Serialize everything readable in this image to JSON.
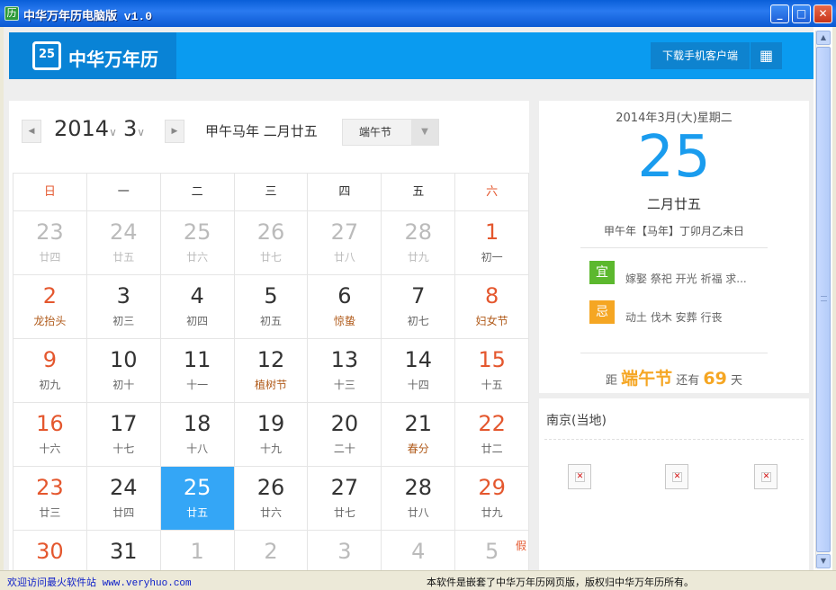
{
  "window": {
    "title": "中华万年历电脑版 v1.0",
    "controls": {
      "minimize": "_",
      "maximize": "□",
      "close": "✕"
    }
  },
  "header": {
    "logo_icon_text": "25",
    "logo_text": "中华万年历",
    "download_label": "下载手机客户端",
    "qr_icon": "qr-code-icon"
  },
  "calendar": {
    "prev_arrow": "◀",
    "next_arrow": "▶",
    "year": "2014",
    "month": "3",
    "caret": "∨",
    "lunar_label": "甲午马年 二月廿五",
    "festival_select": "端午节",
    "festival_arrow": "▼",
    "weekdays": [
      "日",
      "一",
      "二",
      "三",
      "四",
      "五",
      "六"
    ],
    "weeks": [
      [
        {
          "d": "23",
          "s": "廿四",
          "other": true
        },
        {
          "d": "24",
          "s": "廿五",
          "other": true
        },
        {
          "d": "25",
          "s": "廿六",
          "other": true
        },
        {
          "d": "26",
          "s": "廿七",
          "other": true
        },
        {
          "d": "27",
          "s": "廿八",
          "other": true
        },
        {
          "d": "28",
          "s": "廿九",
          "other": true
        },
        {
          "d": "1",
          "s": "初一"
        }
      ],
      [
        {
          "d": "2",
          "s": "龙抬头",
          "fest": true
        },
        {
          "d": "3",
          "s": "初三"
        },
        {
          "d": "4",
          "s": "初四"
        },
        {
          "d": "5",
          "s": "初五"
        },
        {
          "d": "6",
          "s": "惊蛰",
          "fest": true
        },
        {
          "d": "7",
          "s": "初七"
        },
        {
          "d": "8",
          "s": "妇女节",
          "fest": true
        }
      ],
      [
        {
          "d": "9",
          "s": "初九"
        },
        {
          "d": "10",
          "s": "初十"
        },
        {
          "d": "11",
          "s": "十一"
        },
        {
          "d": "12",
          "s": "植树节",
          "fest": true
        },
        {
          "d": "13",
          "s": "十三"
        },
        {
          "d": "14",
          "s": "十四"
        },
        {
          "d": "15",
          "s": "十五"
        }
      ],
      [
        {
          "d": "16",
          "s": "十六"
        },
        {
          "d": "17",
          "s": "十七"
        },
        {
          "d": "18",
          "s": "十八"
        },
        {
          "d": "19",
          "s": "十九"
        },
        {
          "d": "20",
          "s": "二十"
        },
        {
          "d": "21",
          "s": "春分",
          "fest": true
        },
        {
          "d": "22",
          "s": "廿二"
        }
      ],
      [
        {
          "d": "23",
          "s": "廿三"
        },
        {
          "d": "24",
          "s": "廿四"
        },
        {
          "d": "25",
          "s": "廿五",
          "selected": true
        },
        {
          "d": "26",
          "s": "廿六"
        },
        {
          "d": "27",
          "s": "廿七"
        },
        {
          "d": "28",
          "s": "廿八"
        },
        {
          "d": "29",
          "s": "廿九"
        }
      ],
      [
        {
          "d": "30",
          "s": ""
        },
        {
          "d": "31",
          "s": ""
        },
        {
          "d": "1",
          "s": "",
          "other": true
        },
        {
          "d": "2",
          "s": "",
          "other": true
        },
        {
          "d": "3",
          "s": "",
          "other": true
        },
        {
          "d": "4",
          "s": "",
          "other": true
        },
        {
          "d": "5",
          "s": "",
          "other": true,
          "tag": "假"
        }
      ]
    ]
  },
  "detail": {
    "date_line": "2014年3月(大)星期二",
    "day": "25",
    "lunar": "二月廿五",
    "ganzhi": "甲午年【马年】丁卯月乙未日",
    "yi_label": "宜",
    "yi_text": "嫁娶 祭祀 开光 祈福 求...",
    "ji_label": "忌",
    "ji_text": "动土 伐木 安葬 行丧",
    "countdown_prefix": "距",
    "countdown_fest": "端午节",
    "countdown_mid": "还有",
    "countdown_days": "69",
    "countdown_suffix": "天",
    "colors": {
      "yi": "#5cb82e",
      "ji": "#f5a623",
      "accent": "#1a9cee"
    }
  },
  "weather": {
    "city": "南京(当地)",
    "broken_icon": "✕"
  },
  "status": {
    "left": "欢迎访问最火软件站 www.veryhuo.com",
    "right": "本软件是嵌套了中华万年历网页版，版权归中华万年历所有。"
  }
}
